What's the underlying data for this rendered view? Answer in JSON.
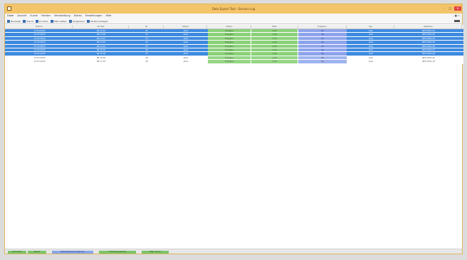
{
  "window": {
    "title": "Data Export Tool - Session Log",
    "controls": {
      "minimize": "–",
      "maximize": "□",
      "close": "✕"
    }
  },
  "menu": {
    "items": [
      "Datei",
      "Ansicht",
      "Suche",
      "Fenster",
      "Verarbeitung",
      "Extras",
      "Einstellungen",
      "Hilfe"
    ],
    "right": "– ■ ✕"
  },
  "toolbar": {
    "buttons": [
      "Neuladen",
      "Export",
      "Drucken",
      "Filter setzen",
      "Gruppieren",
      "Verlauf anzeigen"
    ],
    "icons": [
      "refresh-icon",
      "export-icon",
      "print-icon",
      "filter-icon",
      "group-icon",
      "history-icon"
    ]
  },
  "table": {
    "columns": [
      "Datum",
      "Uhrzeit",
      "ID",
      "Status",
      "Aktion",
      "Wert",
      "Ergebnis",
      "Typ",
      "Referenz"
    ],
    "rows": [
      {
        "selected": true,
        "cells": [
          "13.03.2020",
          "08:12:44",
          "21",
          "aktiv",
          "Freigabe",
          "1,00",
          "OK",
          "Auto",
          "REF-0001-02"
        ]
      },
      {
        "selected": true,
        "cells": [
          "13.03.2020",
          "08:13:05",
          "22",
          "aktiv",
          "Freigabe",
          "1,00",
          "OK",
          "Auto",
          "REF-0001-03"
        ]
      },
      {
        "selected": true,
        "cells": [
          "13.03.2020",
          "08:13:27",
          "23",
          "aktiv",
          "Freigabe",
          "1,00",
          "OK",
          "Auto",
          "REF-0001-04"
        ]
      },
      {
        "selected": true,
        "cells": [
          "13.03.2020",
          "08:14:10",
          "24",
          "aktiv",
          "Freigabe",
          "1,00",
          "OK",
          "Auto",
          "REF-0001-05"
        ]
      },
      {
        "selected": true,
        "cells": [
          "13.03.2020",
          "08:14:52",
          "25",
          "aktiv",
          "Freigabe",
          "1,00",
          "OK",
          "Auto",
          "REF-0001-06"
        ]
      },
      {
        "selected": true,
        "cells": [
          "13.03.2020",
          "08:15:31",
          "26",
          "aktiv",
          "Freigabe",
          "1,00",
          "OK",
          "Auto",
          "REF-0001-07"
        ]
      },
      {
        "selected": true,
        "cells": [
          "13.03.2020",
          "08:16:02",
          "27",
          "aktiv",
          "Freigabe",
          "1,00",
          "OK",
          "Auto",
          "REF-0001-08"
        ]
      },
      {
        "selected": false,
        "cells": [
          "13.03.2020",
          "08:16:40",
          "28",
          "aktiv",
          "Freigabe",
          "1,00",
          "OK",
          "Auto",
          "REF-0001-09"
        ]
      },
      {
        "selected": false,
        "cells": [
          "13.03.2020",
          "08:17:15",
          "29",
          "aktiv",
          "Freigabe",
          "1,00",
          "OK",
          "Auto",
          "REF-0001-10"
        ]
      }
    ]
  },
  "status": {
    "tabs": [
      "Verbunden",
      "Bereit",
      "Aktualisierung erfolgreich",
      "9 Einträge geladen",
      "Filter: keiner"
    ]
  },
  "colors": {
    "title_bar": "#f4c46a",
    "selection": "#3d8ae0",
    "green_cell": "#8bd17a",
    "blue_cell": "#8da4ec"
  }
}
